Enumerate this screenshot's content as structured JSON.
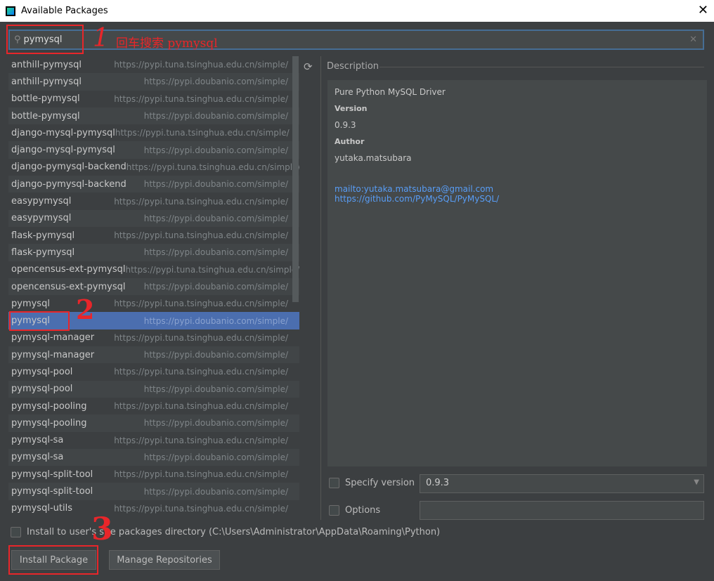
{
  "window": {
    "title": "Available Packages"
  },
  "search": {
    "value": "pymysql"
  },
  "packages": [
    {
      "name": "anthill-pymysql",
      "url": "https://pypi.tuna.tsinghua.edu.cn/simple/"
    },
    {
      "name": "anthill-pymysql",
      "url": "https://pypi.doubanio.com/simple/"
    },
    {
      "name": "bottle-pymysql",
      "url": "https://pypi.tuna.tsinghua.edu.cn/simple/"
    },
    {
      "name": "bottle-pymysql",
      "url": "https://pypi.doubanio.com/simple/"
    },
    {
      "name": "django-mysql-pymysql",
      "url": "https://pypi.tuna.tsinghua.edu.cn/simple/"
    },
    {
      "name": "django-mysql-pymysql",
      "url": "https://pypi.doubanio.com/simple/"
    },
    {
      "name": "django-pymysql-backend",
      "url": "https://pypi.tuna.tsinghua.edu.cn/simple/"
    },
    {
      "name": "django-pymysql-backend",
      "url": "https://pypi.doubanio.com/simple/"
    },
    {
      "name": "easypymysql",
      "url": "https://pypi.tuna.tsinghua.edu.cn/simple/"
    },
    {
      "name": "easypymysql",
      "url": "https://pypi.doubanio.com/simple/"
    },
    {
      "name": "flask-pymysql",
      "url": "https://pypi.tuna.tsinghua.edu.cn/simple/"
    },
    {
      "name": "flask-pymysql",
      "url": "https://pypi.doubanio.com/simple/"
    },
    {
      "name": "opencensus-ext-pymysql",
      "url": "https://pypi.tuna.tsinghua.edu.cn/simple/"
    },
    {
      "name": "opencensus-ext-pymysql",
      "url": "https://pypi.doubanio.com/simple/"
    },
    {
      "name": "pymysql",
      "url": "https://pypi.tuna.tsinghua.edu.cn/simple/"
    },
    {
      "name": "pymysql",
      "url": "https://pypi.doubanio.com/simple/",
      "selected": true
    },
    {
      "name": "pymysql-manager",
      "url": "https://pypi.tuna.tsinghua.edu.cn/simple/"
    },
    {
      "name": "pymysql-manager",
      "url": "https://pypi.doubanio.com/simple/"
    },
    {
      "name": "pymysql-pool",
      "url": "https://pypi.tuna.tsinghua.edu.cn/simple/"
    },
    {
      "name": "pymysql-pool",
      "url": "https://pypi.doubanio.com/simple/"
    },
    {
      "name": "pymysql-pooling",
      "url": "https://pypi.tuna.tsinghua.edu.cn/simple/"
    },
    {
      "name": "pymysql-pooling",
      "url": "https://pypi.doubanio.com/simple/"
    },
    {
      "name": "pymysql-sa",
      "url": "https://pypi.tuna.tsinghua.edu.cn/simple/"
    },
    {
      "name": "pymysql-sa",
      "url": "https://pypi.doubanio.com/simple/"
    },
    {
      "name": "pymysql-split-tool",
      "url": "https://pypi.tuna.tsinghua.edu.cn/simple/"
    },
    {
      "name": "pymysql-split-tool",
      "url": "https://pypi.doubanio.com/simple/"
    },
    {
      "name": "pymysql-utils",
      "url": "https://pypi.tuna.tsinghua.edu.cn/simple/"
    }
  ],
  "description": {
    "label": "Description",
    "summary": "Pure Python MySQL Driver",
    "version_label": "Version",
    "version": "0.9.3",
    "author_label": "Author",
    "author": "yutaka.matsubara",
    "links": [
      "mailto:yutaka.matsubara@gmail.com",
      "https://github.com/PyMySQL/PyMySQL/"
    ]
  },
  "options": {
    "specify_version": "Specify version",
    "version_value": "0.9.3",
    "options_label": "Options"
  },
  "site_install": "Install to user's site packages directory (C:\\Users\\Administrator\\AppData\\Roaming\\Python)",
  "buttons": {
    "install": "Install Package",
    "manage": "Manage Repositories"
  },
  "annotations": {
    "hint": "回车搜索 pymysql",
    "step1": "1",
    "step2": "2",
    "step3": "3"
  },
  "colors": {
    "selection": "#4b6eaf",
    "annotation": "#e8262a",
    "link": "#589df6"
  }
}
